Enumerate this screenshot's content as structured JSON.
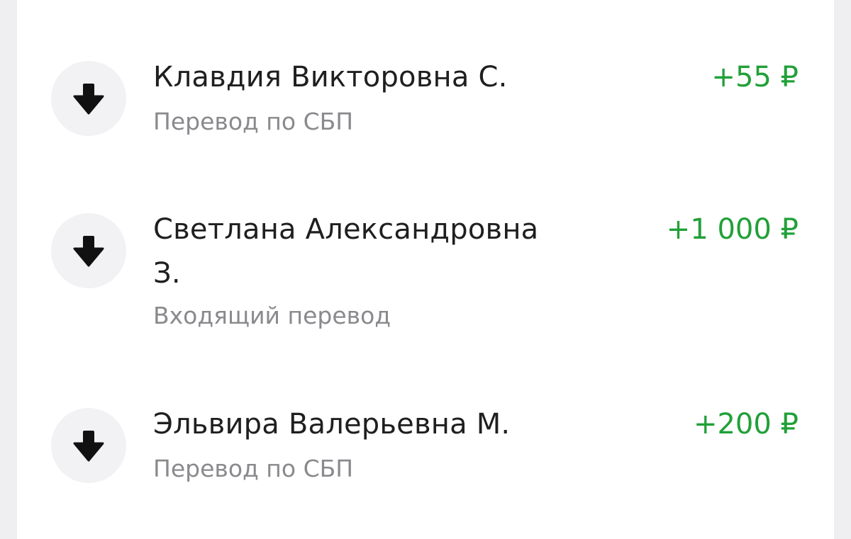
{
  "colors": {
    "background": "#efeff1",
    "panel": "#ffffff",
    "name_text": "#1f1f1f",
    "secondary_text": "#8a8a8e",
    "income_amount": "#21a038",
    "icon_circle": "#f2f2f4"
  },
  "transactions": [
    {
      "icon": "arrow-down-icon",
      "name": "Клавдия Викторовна С.",
      "description": "Перевод по СБП",
      "amount": "+55 ₽"
    },
    {
      "icon": "arrow-down-icon",
      "name": "Светлана Александровна З.",
      "description": "Входящий перевод",
      "amount": "+1 000 ₽"
    },
    {
      "icon": "arrow-down-icon",
      "name": "Эльвира Валерьевна М.",
      "description": "Перевод по СБП",
      "amount": "+200 ₽"
    }
  ]
}
